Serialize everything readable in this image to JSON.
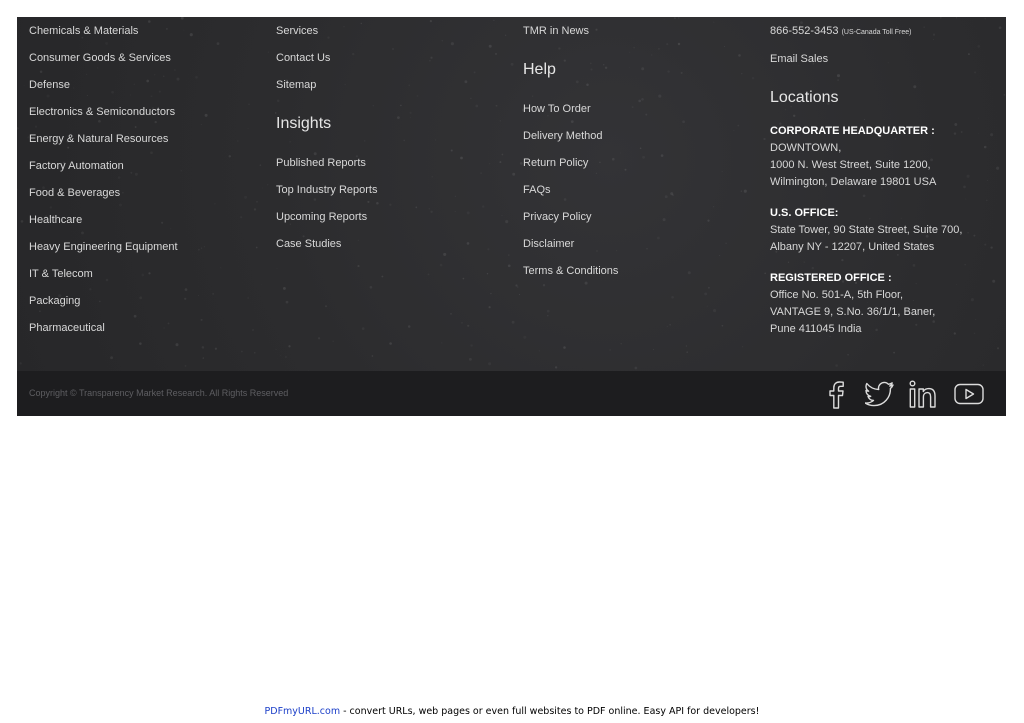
{
  "industries": [
    "Chemicals & Materials",
    "Consumer Goods & Services",
    "Defense",
    "Electronics & Semiconductors",
    "Energy & Natural Resources",
    "Factory Automation",
    "Food & Beverages",
    "Healthcare",
    "Heavy Engineering Equipment",
    "IT & Telecom",
    "Packaging",
    "Pharmaceutical"
  ],
  "company_links": [
    "Services",
    "Contact Us",
    "Sitemap"
  ],
  "insights": {
    "heading": "Insights",
    "links": [
      "Published Reports",
      "Top Industry Reports",
      "Upcoming Reports",
      "Case Studies"
    ]
  },
  "news_link": "TMR in News",
  "help": {
    "heading": "Help",
    "links": [
      "How To Order",
      "Delivery Method",
      "Return Policy",
      "FAQs",
      "Privacy Policy",
      "Disclaimer",
      "Terms & Conditions"
    ]
  },
  "contact": {
    "phone": "866-552-3453",
    "phone_note": "(US-Canada Toll Free)",
    "email": "Email Sales"
  },
  "locations": {
    "heading": "Locations",
    "hq": {
      "title": "CORPORATE HEADQUARTER :",
      "lines": [
        "DOWNTOWN,",
        "1000 N. West Street, Suite 1200,",
        "Wilmington, Delaware 19801 USA"
      ]
    },
    "us": {
      "title": "U.S. OFFICE:",
      "lines": [
        "State Tower, 90 State Street, Suite 700,",
        "Albany NY - 12207, United States"
      ]
    },
    "reg": {
      "title": "REGISTERED OFFICE :",
      "lines": [
        "Office No. 501-A, 5th Floor,",
        "VANTAGE 9, S.No. 36/1/1, Baner,",
        "Pune 411045 India"
      ]
    }
  },
  "copyright": "Copyright © Transparency Market Research. All Rights Reserved",
  "social_icons": [
    "facebook-icon",
    "twitter-icon",
    "linkedin-icon",
    "youtube-icon"
  ],
  "pdf_note": {
    "link": "PDFmyURL.com",
    "text": " - convert URLs, web pages or even full websites to PDF online. Easy API for developers!"
  }
}
